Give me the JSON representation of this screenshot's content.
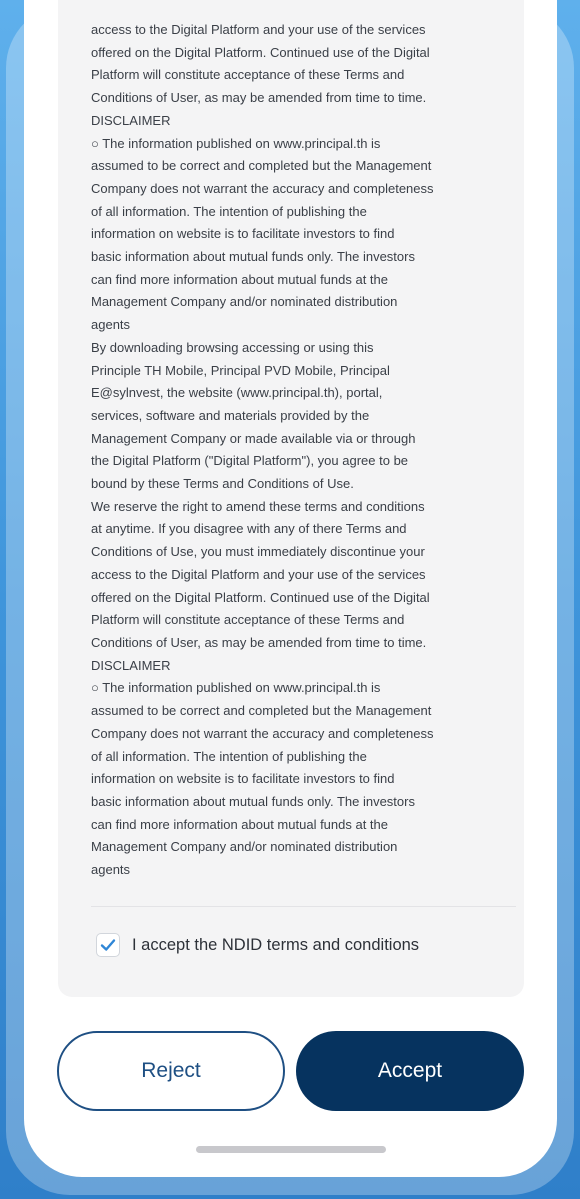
{
  "terms": {
    "body": "access to the Digital Platform and your use of the services\noffered on the Digital Platform. Continued use of the Digital\nPlatform will constitute acceptance of these Terms and\nConditions of User, as may be amended from time to time.\nDISCLAIMER\n○ The information published on www.principal.th is\nassumed to be correct and completed but the Management\nCompany does not warrant the accuracy and completeness\nof all information. The intention of publishing the\ninformation on website is to facilitate investors to find\nbasic information about mutual funds only. The investors\ncan find more information about mutual funds at the\nManagement Company and/or nominated distribution\nagents\nBy downloading browsing accessing or using this\nPrinciple TH Mobile, Principal PVD Mobile, Principal\nE@sylnvest, the website (www.principal.th), portal,\nservices, software and materials provided by the\nManagement Company or made available via or through\nthe Digital Platform (\"Digital Platform\"), you agree to be\nbound by these Terms and Conditions of Use.\nWe reserve the right to amend these terms and conditions\nat anytime. If you disagree with any of there Terms and\nConditions of Use, you must immediately discontinue your\naccess to the Digital Platform and your use of the services\noffered on the Digital Platform. Continued use of the Digital\nPlatform will constitute acceptance of these Terms and\nConditions of User, as may be amended from time to time.\nDISCLAIMER\n○ The information published on www.principal.th is\nassumed to be correct and completed but the Management\nCompany does not warrant the accuracy and completeness\nof all information. The intention of publishing the\ninformation on website is to facilitate investors to find\nbasic information about mutual funds only. The investors\ncan find more information about mutual funds at the\nManagement Company and/or nominated distribution\nagents"
  },
  "consent": {
    "checked": true,
    "label": "I accept the NDID terms and conditions",
    "check_icon": "checkmark-icon"
  },
  "actions": {
    "reject_label": "Reject",
    "accept_label": "Accept"
  },
  "colors": {
    "primary": "#06335f",
    "outline": "#1e4f83",
    "check": "#2f86d6",
    "background": "#3f95db"
  }
}
